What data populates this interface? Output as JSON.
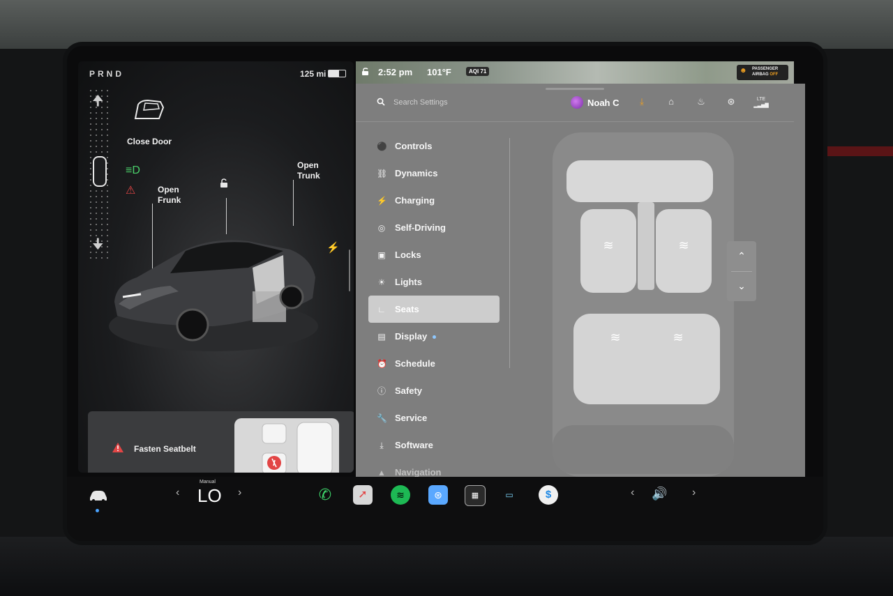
{
  "status": {
    "gear": "PRND",
    "range": "125 mi",
    "battery_level_percent": 62,
    "time": "2:52 pm",
    "temperature": "101°F",
    "aqi": "AQI 71",
    "airbag_line1": "PASSENGER",
    "airbag_line2a": "AIRBAG",
    "airbag_line2b": "OFF"
  },
  "car": {
    "close_door": "Close Door",
    "open_frunk_1": "Open",
    "open_frunk_2": "Frunk",
    "open_trunk_1": "Open",
    "open_trunk_2": "Trunk"
  },
  "alert": {
    "text": "Fasten Seatbelt"
  },
  "settings": {
    "search_placeholder": "Search Settings",
    "profile_name": "Noah C",
    "lte": "LTE",
    "menu": [
      {
        "label": "Controls",
        "icon": "toggle-icon"
      },
      {
        "label": "Dynamics",
        "icon": "car-icon"
      },
      {
        "label": "Charging",
        "icon": "bolt-icon"
      },
      {
        "label": "Self-Driving",
        "icon": "steering-wheel-icon"
      },
      {
        "label": "Locks",
        "icon": "lock-icon"
      },
      {
        "label": "Lights",
        "icon": "sun-icon"
      },
      {
        "label": "Seats",
        "icon": "seat-icon"
      },
      {
        "label": "Display",
        "icon": "display-icon"
      },
      {
        "label": "Schedule",
        "icon": "alarm-icon"
      },
      {
        "label": "Safety",
        "icon": "info-icon"
      },
      {
        "label": "Service",
        "icon": "wrench-icon"
      },
      {
        "label": "Software",
        "icon": "download-icon"
      },
      {
        "label": "Navigation",
        "icon": "navigation-icon"
      }
    ],
    "active": "Seats"
  },
  "bottom": {
    "climate_mode": "Manual",
    "climate_temp": "LO"
  },
  "colors": {
    "accent_green": "#4ad06a",
    "alert_red": "#e24545",
    "download_orange": "#f0a020",
    "settings_bg": "#7e7e7e",
    "active_item_bg": "#cdcdcd"
  }
}
